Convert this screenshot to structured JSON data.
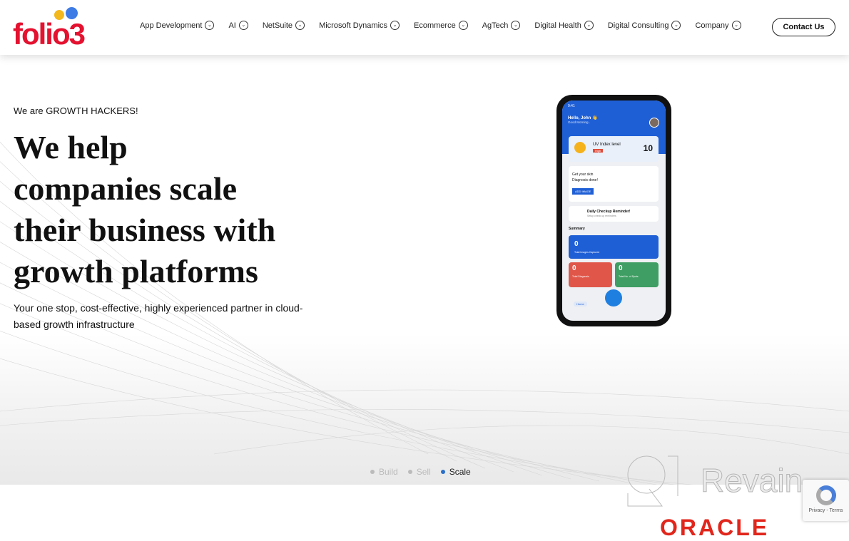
{
  "header": {
    "logo_text": "folio3",
    "nav": [
      {
        "label": "App Development"
      },
      {
        "label": "AI"
      },
      {
        "label": "NetSuite"
      },
      {
        "label": "Microsoft Dynamics"
      },
      {
        "label": "Ecommerce"
      },
      {
        "label": "AgTech"
      },
      {
        "label": "Digital Health"
      },
      {
        "label": "Digital Consulting"
      },
      {
        "label": "Company"
      }
    ],
    "contact_label": "Contact Us"
  },
  "hero": {
    "eyebrow": "We are GROWTH HACKERS!",
    "title_lines": [
      "We help",
      "companies scale",
      "their business with",
      "growth platforms"
    ],
    "subtitle": "Your one stop, cost-effective, highly experienced partner in cloud-based growth infrastructure",
    "steps": [
      {
        "label": "Build",
        "active": false
      },
      {
        "label": "Sell",
        "active": false
      },
      {
        "label": "Scale",
        "active": true
      }
    ]
  },
  "phone": {
    "time": "9:41",
    "greeting": "Hello, John 👋",
    "greeting_sub": "Good Morning..",
    "uv_label": "UV Index level",
    "uv_badge": "High",
    "uv_value": "10",
    "skin_text": "Get your skin Diagnosis done!",
    "add_image": "ADD IMAGE",
    "reminder_title": "Daily Checkup Reminder!",
    "reminder_sub": "Setup check up reminders",
    "summary": "Summary",
    "images_value": "0",
    "images_label": "Total Images Captured",
    "diag_value": "0",
    "diag_label": "Total Diagnosis",
    "spots_value": "0",
    "spots_label": "Total No. of Spots",
    "home": "Home"
  },
  "watermark": "Revain",
  "recaptcha": "Privacy - Terms",
  "partner_logo": "ORACLE",
  "colors": {
    "brand_red": "#e4112f",
    "accent_blue": "#2a6fc9",
    "phone_blue": "#1f5fd6"
  }
}
